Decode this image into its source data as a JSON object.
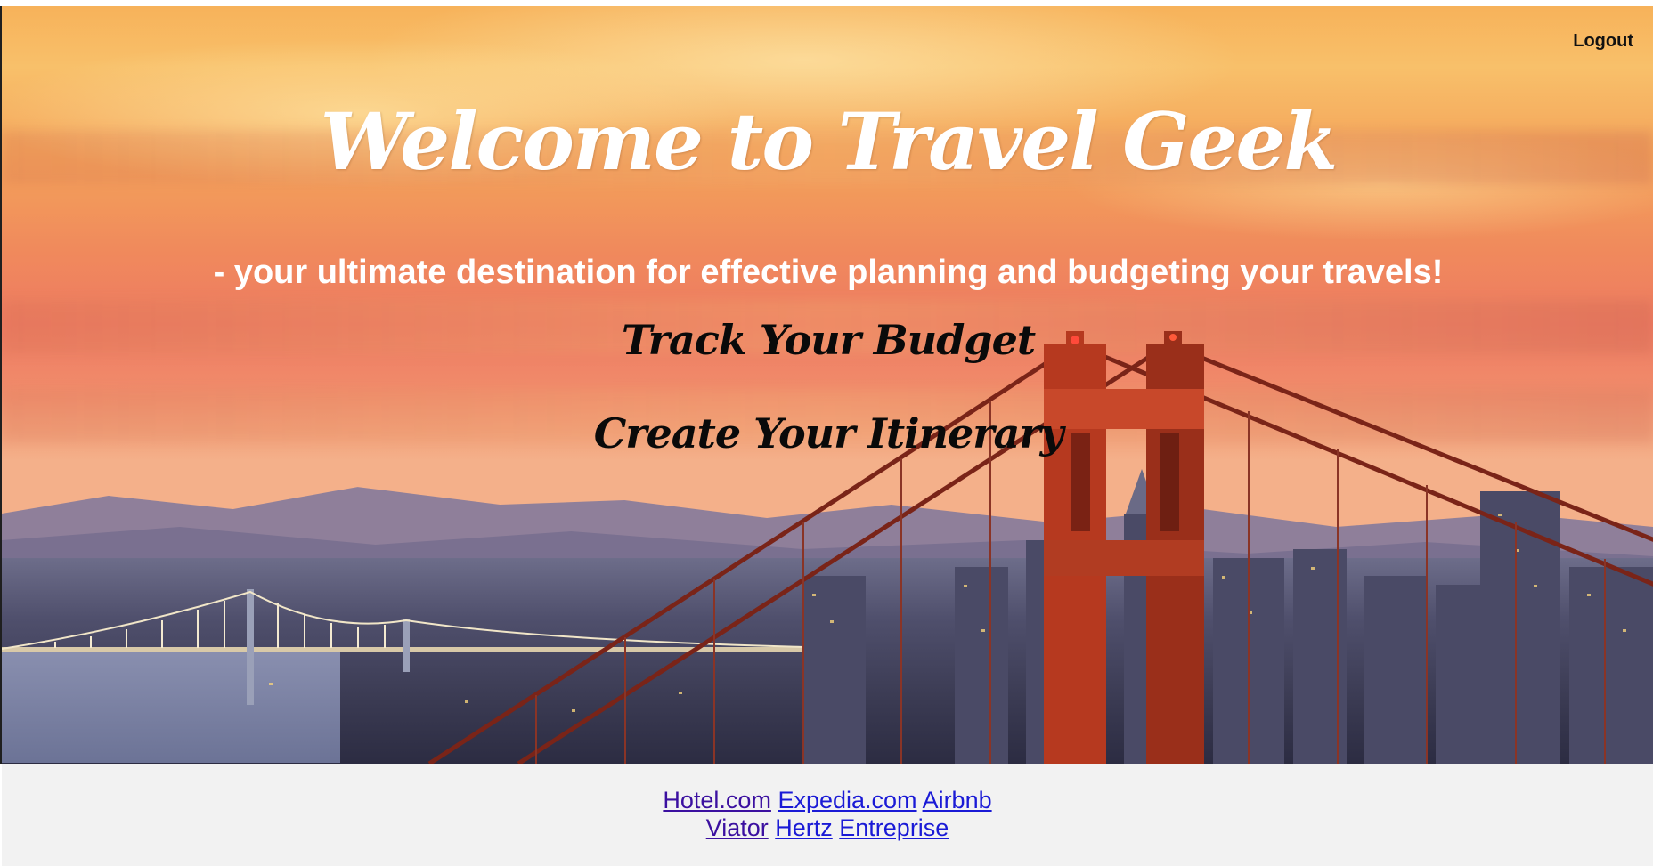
{
  "header": {
    "logout_label": "Logout"
  },
  "hero": {
    "title": "Welcome to Travel Geek",
    "tagline": "- your ultimate destination for effective planning and budgeting your travels!",
    "actions": [
      {
        "label": "Track Your Budget"
      },
      {
        "label": "Create Your Itinerary"
      }
    ]
  },
  "footer": {
    "links_row1": [
      {
        "label": "Hotel.com"
      },
      {
        "label": "Expedia.com"
      },
      {
        "label": "Airbnb"
      }
    ],
    "links_row2": [
      {
        "label": "Viator"
      },
      {
        "label": "Hertz"
      },
      {
        "label": "Entreprise"
      }
    ]
  },
  "colors": {
    "title_text": "#ffffff",
    "action_text": "#0a0a0a",
    "visited_link": "#3b10a0",
    "link": "#1a1ad6",
    "footer_bg": "#f2f2f2"
  }
}
